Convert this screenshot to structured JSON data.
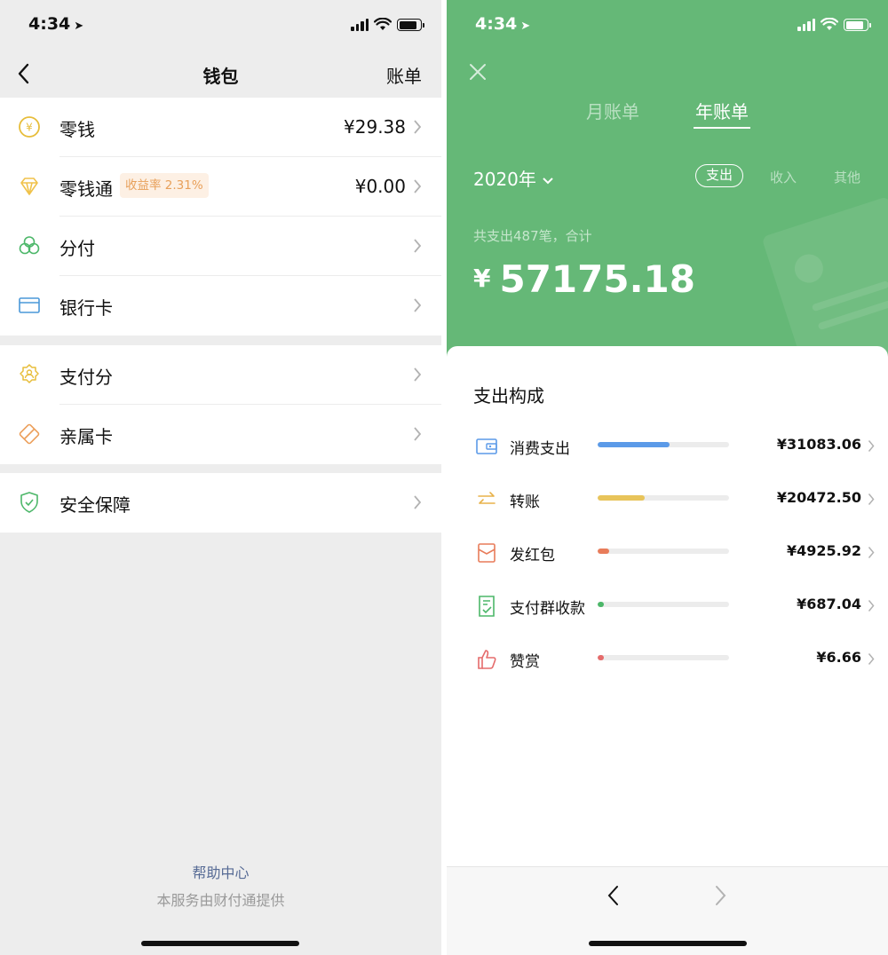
{
  "status": {
    "time": "4:34",
    "location_icon": "location-arrow-icon"
  },
  "wallet": {
    "title": "钱包",
    "bill_label": "账单",
    "groups": [
      [
        {
          "label": "零钱",
          "value": "¥29.38",
          "icon": "coin-yen-icon",
          "color": "#e7bd3a"
        },
        {
          "label": "零钱通",
          "value": "¥0.00",
          "icon": "diamond-icon",
          "color": "#f0c24b",
          "tag": "收益率 2.31%"
        },
        {
          "label": "分付",
          "value": "",
          "icon": "clover-icon",
          "color": "#4cb769"
        },
        {
          "label": "银行卡",
          "value": "",
          "icon": "card-icon",
          "color": "#4a98d9"
        }
      ],
      [
        {
          "label": "支付分",
          "value": "",
          "icon": "gear-badge-icon",
          "color": "#e7bd3a"
        },
        {
          "label": "亲属卡",
          "value": "",
          "icon": "family-card-icon",
          "color": "#ec9f5a"
        }
      ],
      [
        {
          "label": "安全保障",
          "value": "",
          "icon": "shield-icon",
          "color": "#4cb769"
        }
      ]
    ],
    "help_link": "帮助中心",
    "provider": "本服务由财付通提供"
  },
  "bill": {
    "tabs": [
      "月账单",
      "年账单"
    ],
    "active_tab": 1,
    "year": "2020年",
    "filters": [
      "支出",
      "收入",
      "其他"
    ],
    "summary": "共支出487笔，合计",
    "currency": "¥",
    "total": "57175.18",
    "section_title": "支出构成",
    "items": [
      {
        "name": "消费支出",
        "amount": "¥31083.06",
        "share": 0.544,
        "color": "#5b9ae8",
        "icon": "wallet-icon"
      },
      {
        "name": "转账",
        "amount": "¥20472.50",
        "share": 0.358,
        "color": "#e8c45a",
        "icon": "transfer-icon"
      },
      {
        "name": "发红包",
        "amount": "¥4925.92",
        "share": 0.086,
        "color": "#e87c5a",
        "icon": "red-packet-icon"
      },
      {
        "name": "支付群收款",
        "amount": "¥687.04",
        "share": 0.012,
        "color": "#4cb769",
        "icon": "group-collect-icon"
      },
      {
        "name": "赞赏",
        "amount": "¥6.66",
        "share": 0.0001,
        "color": "#e56b6b",
        "icon": "thumbs-up-icon"
      }
    ]
  },
  "colors": {
    "hero_green": "#65b877",
    "link_blue": "#576b95"
  }
}
